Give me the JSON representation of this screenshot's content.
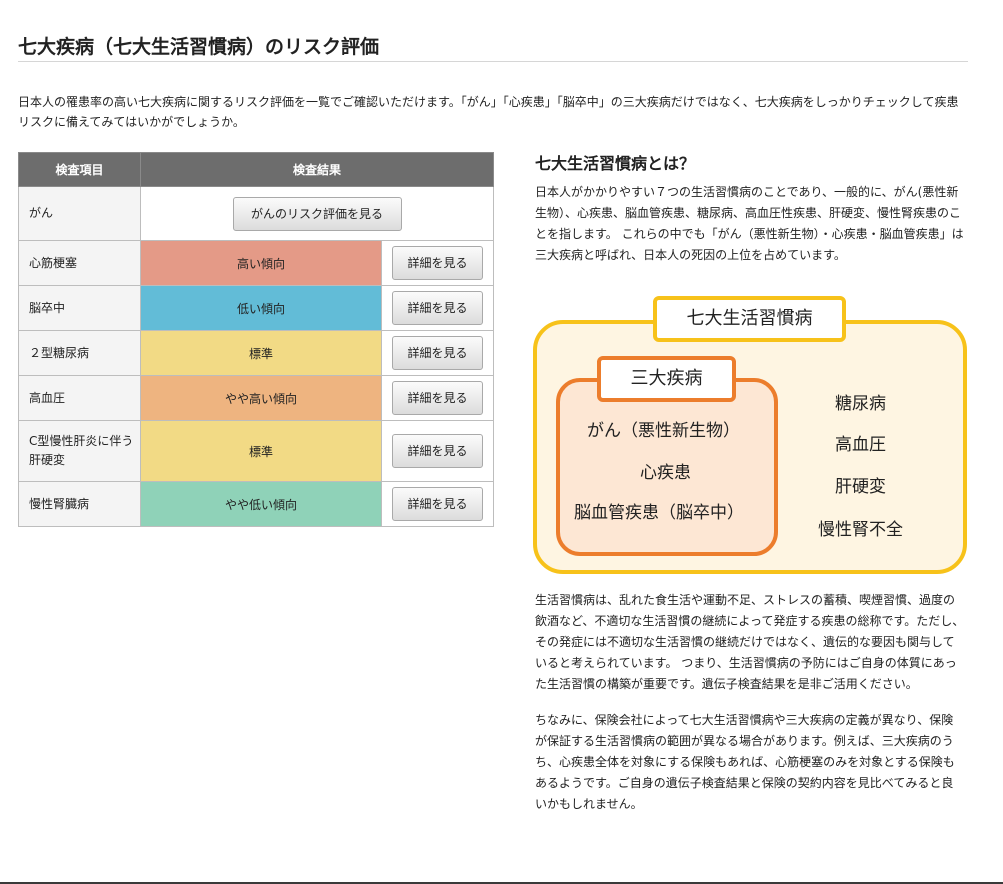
{
  "page": {
    "title": "七大疾病（七大生活習慣病）のリスク評価",
    "intro": "日本人の罹患率の高い七大疾病に関するリスク評価を一覧でご確認いただけます。「がん」「心疾患」「脳卒中」の三大疾病だけではなく、七大疾病をしっかりチェックして疾患リスクに備えてみてはいかがでしょうか。"
  },
  "table": {
    "headers": [
      "検査項目",
      "検査結果"
    ],
    "cancer": {
      "item": "がん",
      "button": "がんのリスク評価を見る"
    },
    "rows": [
      {
        "item": "心筋梗塞",
        "result": "高い傾向",
        "color": "#e49a87",
        "button": "詳細を見る"
      },
      {
        "item": "脳卒中",
        "result": "低い傾向",
        "color": "#62bcd7",
        "button": "詳細を見る"
      },
      {
        "item": "２型糖尿病",
        "result": "標準",
        "color": "#f2da85",
        "button": "詳細を見る"
      },
      {
        "item": "高血圧",
        "result": "やや高い傾向",
        "color": "#eeb480",
        "button": "詳細を見る"
      },
      {
        "item": "C型慢性肝炎に伴う肝硬変",
        "result": "標準",
        "color": "#f2da85",
        "button": "詳細を見る"
      },
      {
        "item": "慢性腎臓病",
        "result": "やや低い傾向",
        "color": "#8fd2b8",
        "button": "詳細を見る"
      }
    ]
  },
  "sidebar": {
    "title": "七大生活習慣病とは？",
    "paragraph1": "日本人がかかりやすい７つの生活習慣病のことであり、一般的に、がん(悪性新生物）、心疾患、脳血管疾患、糖尿病、高血圧性疾患、肝硬変、慢性腎疾患のことを指します。 これらの中でも「がん（悪性新生物）・心疾患・脳血管疾患」は三大疾病と呼ばれ、日本人の死因の上位を占めています。",
    "paragraph2": "生活習慣病は、乱れた食生活や運動不足、ストレスの蓄積、喫煙習慣、過度の飲酒など、不適切な生活習慣の継続によって発症する疾患の総称です。ただし、その発症には不適切な生活習慣の継続だけではなく、遺伝的な要因も関与していると考えられています。 つまり、生活習慣病の予防にはご自身の体質にあった生活習慣の構築が重要です。遺伝子検査結果を是非ご活用ください。",
    "paragraph3": "ちなみに、保険会社によって七大生活習慣病や三大疾病の定義が異なり、保険が保証する生活習慣病の範囲が異なる場合があります。例えば、三大疾病のうち、心疾患全体を対象にする保険もあれば、心筋梗塞のみを対象とする保険もあるようです。ご自身の遺伝子検査結果と保険の契約内容を見比べてみると良いかもしれません。"
  },
  "diagram": {
    "outer_label": "七大生活習慣病",
    "inner_label": "三大疾病",
    "inner_items": [
      "がん（悪性新生物）",
      "心疾患",
      "脳血管疾患（脳卒中）"
    ],
    "outer_items": [
      "糖尿病",
      "高血圧",
      "肝硬変",
      "慢性腎不全"
    ],
    "outer_color": "#f7c21a",
    "inner_color": "#ec7d2c"
  }
}
